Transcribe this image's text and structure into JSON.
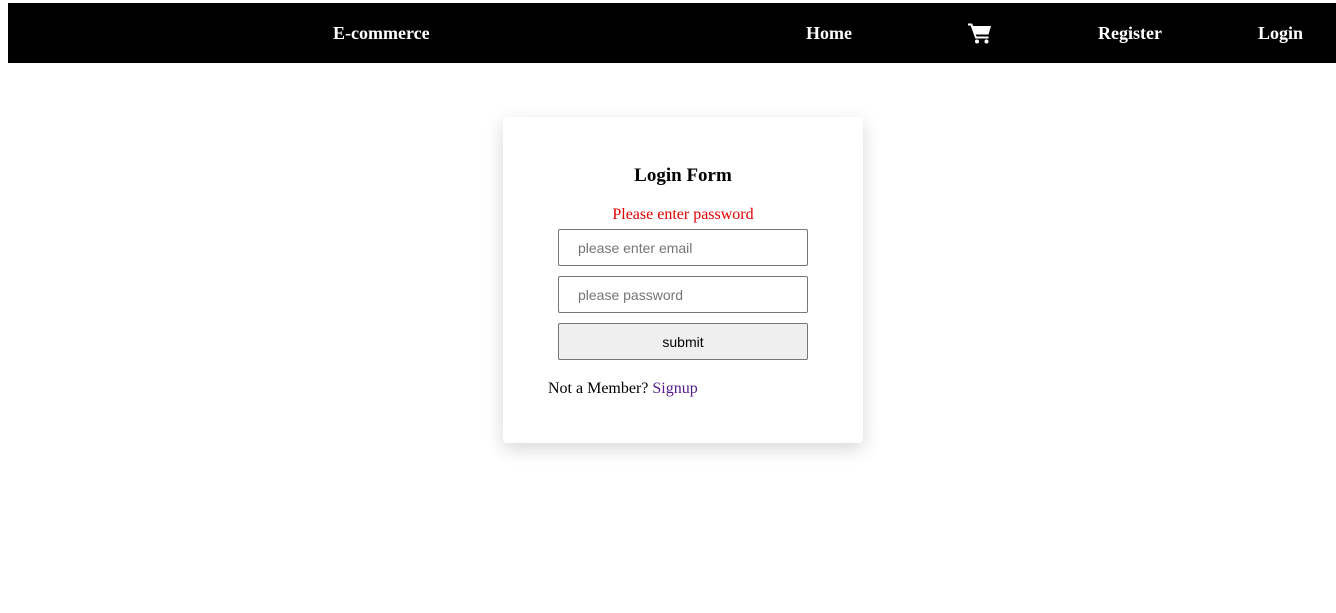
{
  "navbar": {
    "brand": "E-commerce",
    "home": "Home",
    "cart_icon": "shopping-cart-icon",
    "register": "Register",
    "login": "Login",
    "background": "#000000",
    "text_color": "#ffffff"
  },
  "login_form": {
    "title": "Login Form",
    "error_message": "Please enter password",
    "error_color": "#e00000",
    "email": {
      "value": "",
      "placeholder": "please enter email"
    },
    "password": {
      "value": "",
      "placeholder": "please password"
    },
    "submit_label": "submit",
    "footer_text": "Not a Member?",
    "signup_link": "Signup",
    "link_color": "#551a8b"
  }
}
